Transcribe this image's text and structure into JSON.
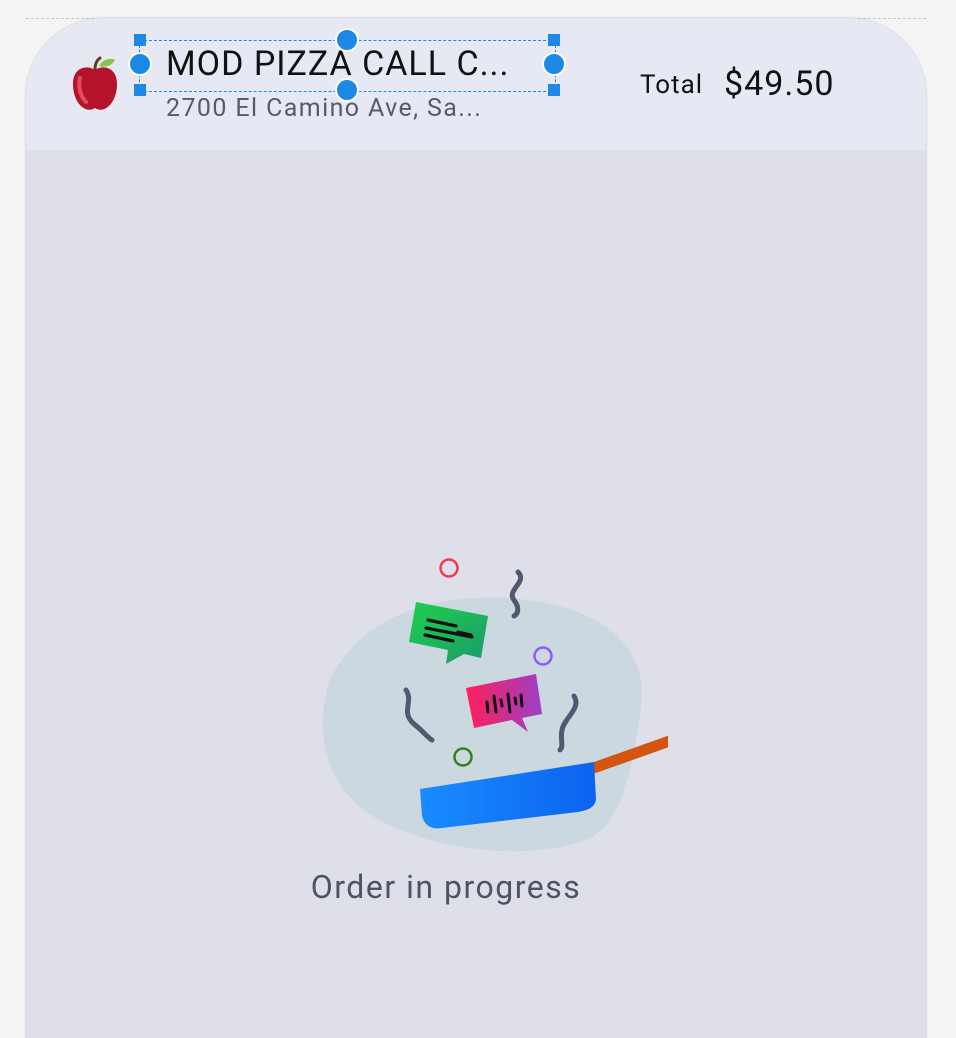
{
  "header": {
    "restaurant_name": "MOD PIZZA CALL C...",
    "address": "2700 El Camino Ave, Sa...",
    "total_label": "Total",
    "total_value": "$49.50",
    "logo_icon": "apple-icon"
  },
  "main": {
    "status_text": "Order in progress",
    "illustration_icon": "cooking-pan-illustration"
  },
  "colors": {
    "header_bg": "#e6e9f3",
    "body_bg": "#dedfe9",
    "selection": "#1e88e5",
    "pan": "#1e7ff5",
    "handle": "#d4550f"
  }
}
